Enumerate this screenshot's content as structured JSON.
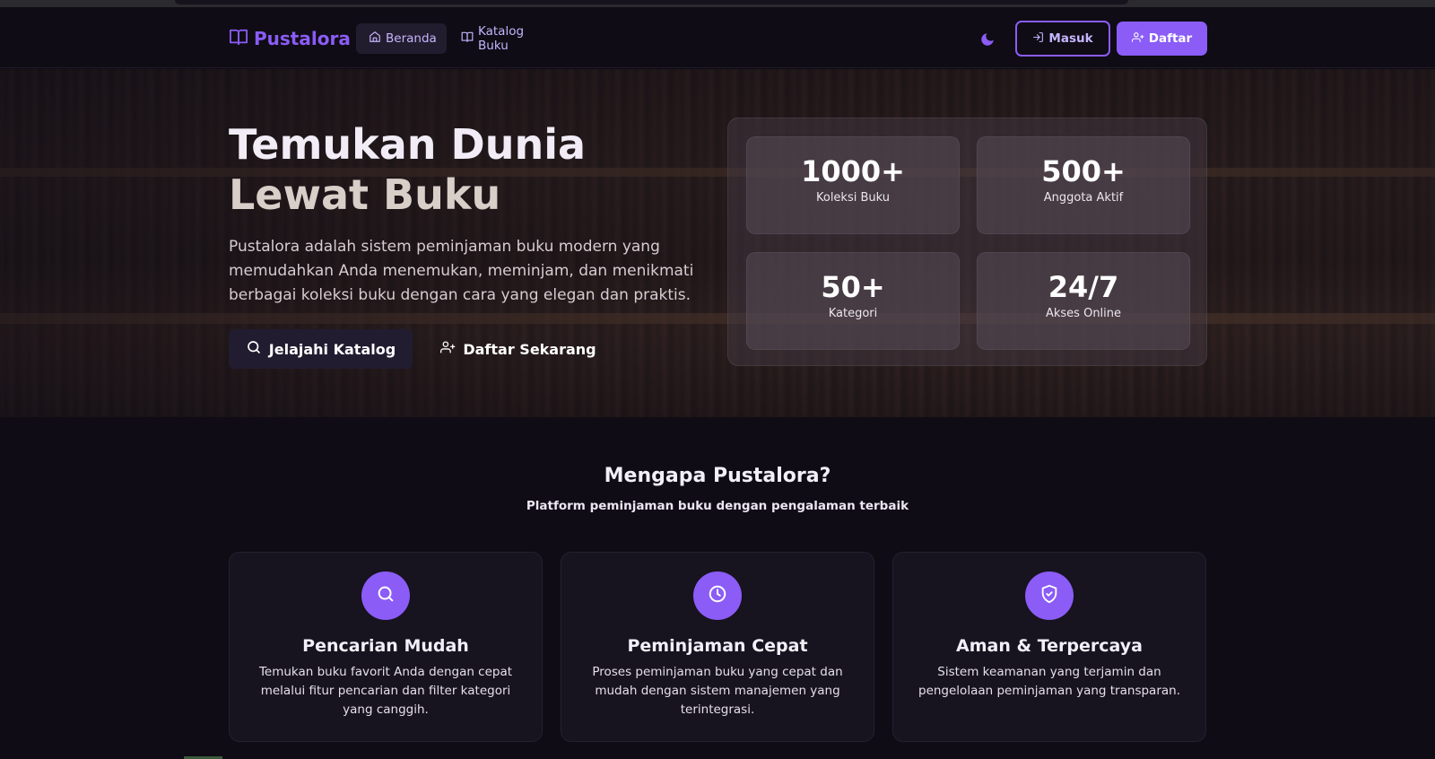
{
  "nav": {
    "brand": "Pustalora",
    "links": [
      {
        "label": "Beranda",
        "active": true
      },
      {
        "label": "Katalog Buku",
        "active": false
      }
    ],
    "login_label": "Masuk",
    "register_label": "Daftar"
  },
  "hero": {
    "title_line1": "Temukan Dunia",
    "title_line2": "Lewat Buku",
    "description": "Pustalora adalah sistem peminjaman buku modern yang memudahkan Anda menemukan, meminjam, dan menikmati berbagai koleksi buku dengan cara yang elegan dan praktis.",
    "cta_primary": "Jelajahi Katalog",
    "cta_secondary": "Daftar Sekarang"
  },
  "stats": [
    {
      "value": "1000+",
      "label": "Koleksi Buku"
    },
    {
      "value": "500+",
      "label": "Anggota Aktif"
    },
    {
      "value": "50+",
      "label": "Kategori"
    },
    {
      "value": "24/7",
      "label": "Akses Online"
    }
  ],
  "why": {
    "title": "Mengapa Pustalora?",
    "subtitle": "Platform peminjaman buku dengan pengalaman terbaik"
  },
  "features": [
    {
      "icon": "search-icon",
      "title": "Pencarian Mudah",
      "description": "Temukan buku favorit Anda dengan cepat melalui fitur pencarian dan filter kategori yang canggih."
    },
    {
      "icon": "clock-icon",
      "title": "Peminjaman Cepat",
      "description": "Proses peminjaman buku yang cepat dan mudah dengan sistem manajemen yang terintegrasi."
    },
    {
      "icon": "shield-check-icon",
      "title": "Aman & Terpercaya",
      "description": "Sistem keamanan yang terjamin dan pengelolaan peminjaman yang transparan."
    }
  ],
  "colors": {
    "accent": "#8b5cf6",
    "background": "#0f0c15",
    "card": "#17131f"
  }
}
